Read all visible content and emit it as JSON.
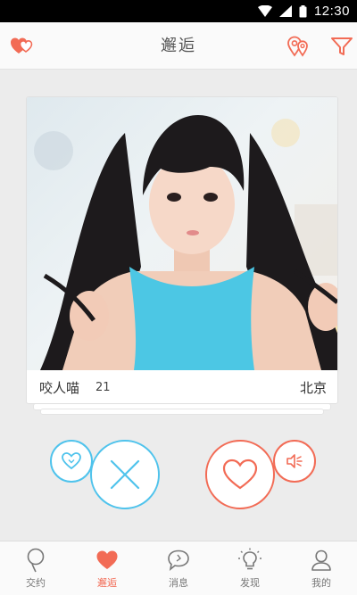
{
  "status_bar": {
    "time": "12:30"
  },
  "header": {
    "title": "邂逅"
  },
  "profile": {
    "name": "咬人喵",
    "age": "21",
    "city": "北京"
  },
  "colors": {
    "accent": "#f26b55",
    "blue": "#4fc3ec",
    "text": "#555555"
  },
  "tabs": [
    {
      "label": "交约",
      "icon": "pin-icon",
      "active": false
    },
    {
      "label": "邂逅",
      "icon": "heart-icon",
      "active": true
    },
    {
      "label": "消息",
      "icon": "message-icon",
      "active": false
    },
    {
      "label": "发现",
      "icon": "lightbulb-icon",
      "active": false
    },
    {
      "label": "我的",
      "icon": "person-icon",
      "active": false
    }
  ]
}
